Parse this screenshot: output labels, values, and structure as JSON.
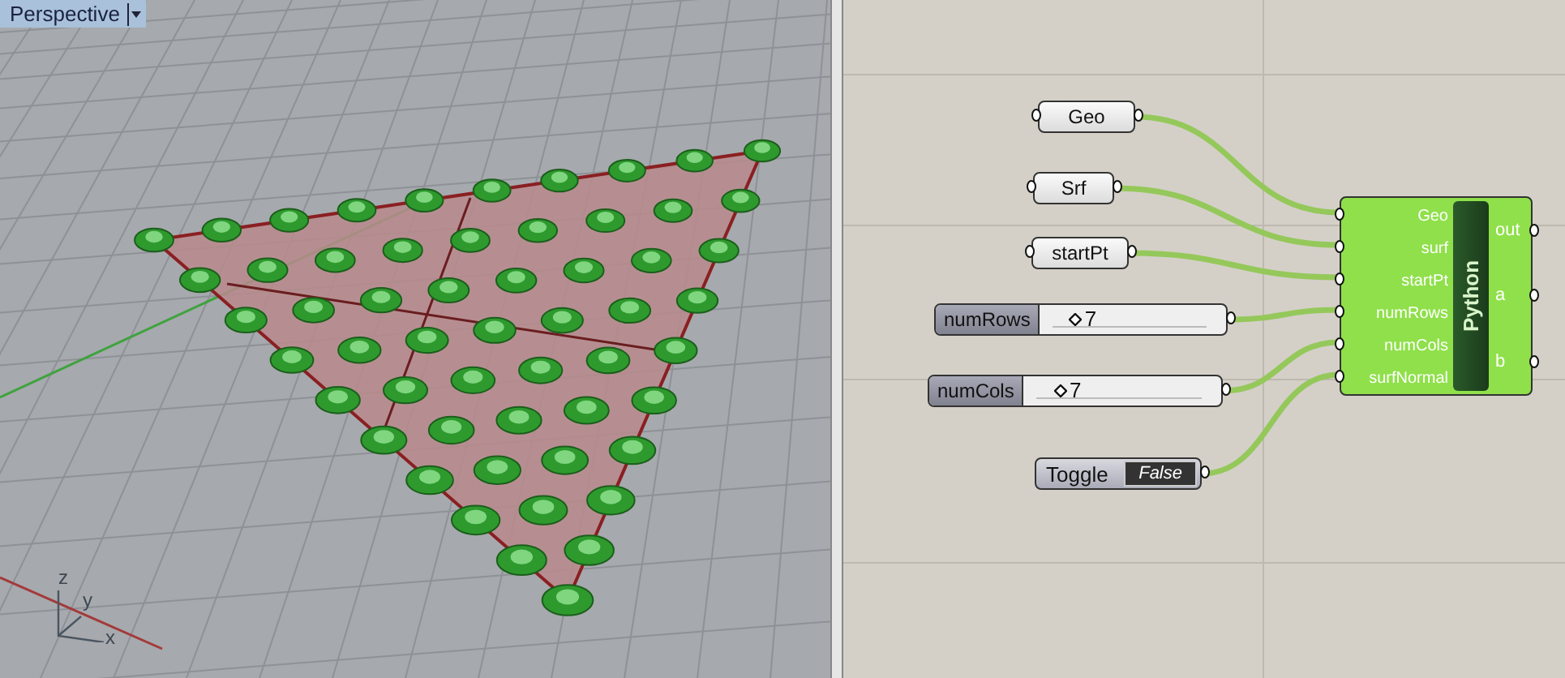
{
  "viewport": {
    "title": "Perspective",
    "axes": [
      "z",
      "y",
      "x"
    ]
  },
  "canvas": {
    "nodes": [
      {
        "kind": "param",
        "label": "Geo"
      },
      {
        "kind": "param",
        "label": "Srf"
      },
      {
        "kind": "param",
        "label": "startPt"
      },
      {
        "kind": "slider",
        "label": "numRows",
        "value": "7",
        "level": 0.1
      },
      {
        "kind": "slider",
        "label": "numCols",
        "value": "7",
        "level": 0.1
      },
      {
        "kind": "toggle",
        "label": "Toggle",
        "value": "False",
        "on": false
      }
    ],
    "component": {
      "title": "Python",
      "inputs": [
        "Geo",
        "surf",
        "startPt",
        "numRows",
        "numCols",
        "surfNormal"
      ],
      "outputs": [
        "out",
        "a",
        "b"
      ]
    }
  }
}
